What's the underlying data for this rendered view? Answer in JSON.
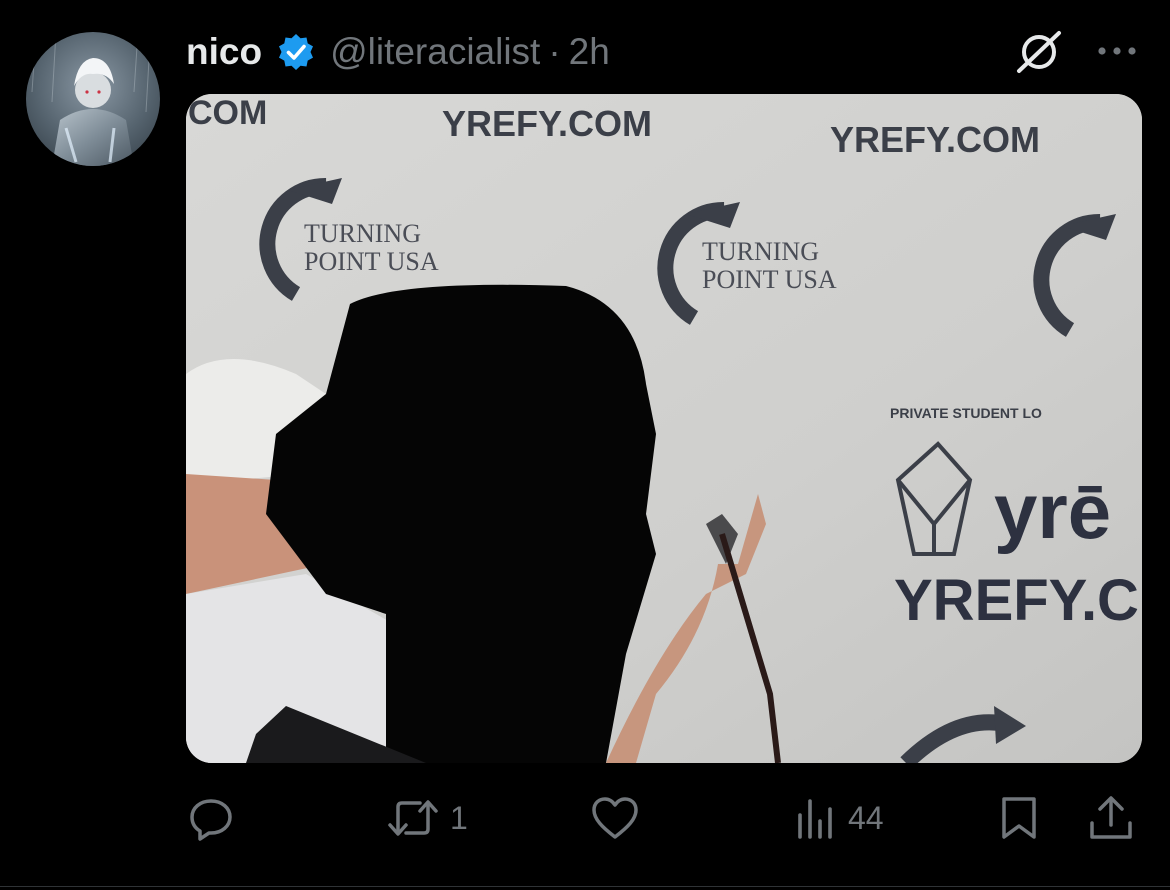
{
  "tweet": {
    "author_name": "nico",
    "handle": "@literacialist",
    "separator": "·",
    "time": "2h",
    "verified": true,
    "icons": {
      "verified": "verified-badge-icon",
      "grok": "grok-icon",
      "more": "more-options-icon"
    }
  },
  "media": {
    "backdrop_texts": {
      "site_top_left": "COM",
      "site_top_center": "YREFY.COM",
      "site_top_right": "YREFY.COM",
      "brand_line1": "TURNING",
      "brand_line2": "POINT USA",
      "banner": "PRIVATE STUDENT LO",
      "logo_word": "yrē",
      "site_right": "YREFY.C"
    }
  },
  "actions": {
    "reply": {
      "icon": "reply-icon",
      "count": ""
    },
    "retweet": {
      "icon": "retweet-icon",
      "count": "1"
    },
    "like": {
      "icon": "heart-icon",
      "count": ""
    },
    "views": {
      "icon": "views-icon",
      "count": "44"
    },
    "bookmark": {
      "icon": "bookmark-icon"
    },
    "share": {
      "icon": "share-icon"
    }
  },
  "colors": {
    "background": "#000000",
    "text_primary": "#e7e9ea",
    "text_secondary": "#71767b",
    "verified_blue": "#1d9bf0"
  }
}
